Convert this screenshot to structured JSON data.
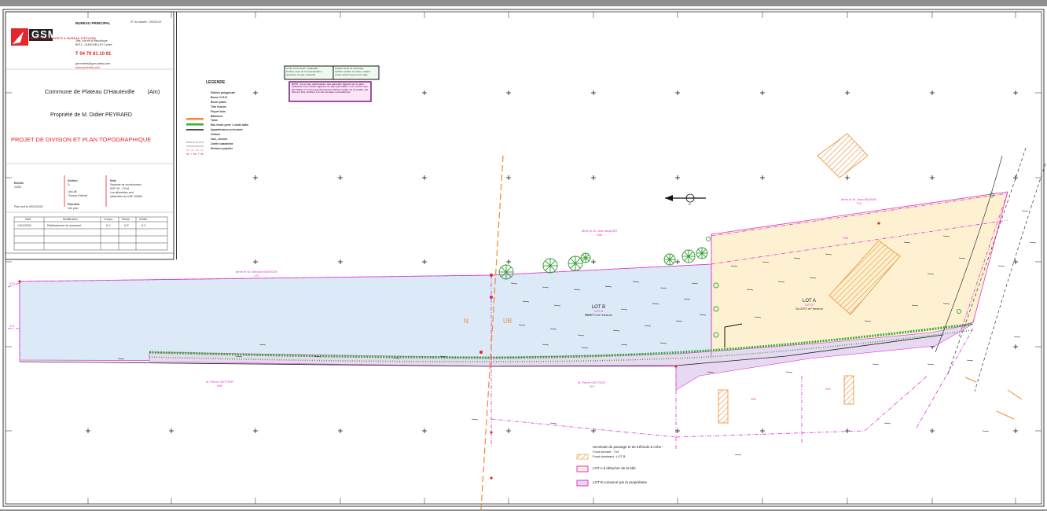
{
  "title_block": {
    "logo": "GSM",
    "logo_sub": "GÉOMÈTRES-EXPERTS & BUREAU D'ÉTUDES",
    "office": "BUREAU PRINCIPAL",
    "address": [
      "1bis, rue de la République",
      "BP12 - 01500 BELLEY Cedex"
    ],
    "phone": "T 04 79 81 10 91",
    "email": "geometres@gsm-belley.com",
    "web": "www.gsmbelley.com",
    "file_number": "N° du dossier : 2020/3 AT",
    "commune": "Commune de Plateau D'Hauteville",
    "department": "(Ain)",
    "owner": "Propriété de M. Didier PEYRARD",
    "project": "PROJET DE DIVISION ET PLAN TOPOGRAPHIQUE",
    "scale_label": "Echelle",
    "scale": "1/200",
    "section_label": "Section",
    "section": "D",
    "place_label": "Lieu-dit",
    "place": "\"Source d'Arbey\"",
    "parcels_label": "Parcelles",
    "parcels": "Voir plan",
    "plan_date": "Plan levé le 09/10/2020",
    "notes_label": "Note",
    "notes": [
      "Système de coordonnées",
      "RGF 93 - CC46",
      "Les altimétries sont",
      "rattachées au NGF-IGN69"
    ],
    "history_headers": [
      "Date",
      "Modification",
      "Compo",
      "Étudié",
      "Vérifié"
    ],
    "history_rows": [
      [
        "14/10/2020",
        "Etablissement du document",
        "K.C",
        "N.P",
        "K.C"
      ]
    ]
  },
  "legend": {
    "title": "LEGENDE",
    "items": [
      "Station polygonale",
      "Borne O.G.E.",
      "Borne plane",
      "Tête d'arbre",
      "Piquet bois",
      "Bâtiment",
      "Talus",
      "Mur limite privé / Limite bâtie",
      "Appartenance présumée",
      "Clôture",
      "Voie, chemin",
      "Limite cadastrale",
      "Division projetée"
    ]
  },
  "notes_boxes": {
    "green": [
      "Limite communale / cadastrale",
      "Surface issue de la représentation graphique du plan cadastral"
    ],
    "green_right": [
      "Surface issue du mesurage",
      "Surface vérifiée sur place, surface exacte déterminée par bornage"
    ],
    "purple": "NOTA : Au vu des informations des parcelles figurant sur le plan cadastral et les limites figurées au plan parcellaire, il en ressort que, des limites ne correspondent qu'aux limites réelles de propriété, qui devront être vérifiées lors du bornage contradictoire."
  },
  "plan": {
    "lot_a": "LOT A",
    "lot_a_ref": "1470.D",
    "lot_a_area": "Sa 2972 m² environ",
    "lot_b": "LOT B",
    "lot_b_ref": "1471.D",
    "lot_b_area": "Sa 4774 m² environ",
    "owner_bl": "Mme et M. Bernard MASSON",
    "owner_bl_ref": "470",
    "owner_top": "Mme et M. Jean MAZUIR",
    "owner_top_ref": "459",
    "owner_tr": "Mme et M. Jean MAZUIR",
    "owner_tr_ref": "710",
    "owner_bottom_left": "M. Pierre GEYTIER",
    "owner_bottom_left_ref": "885",
    "owner_bottom_mid": "M. Pierre GEYTIER",
    "owner_bottom_mid_ref": "719",
    "parcel_708": "708",
    "parcel_153": "153",
    "parcel_152": "152",
    "parcel_471": "471",
    "parcel_470": "470",
    "zone_n": "N",
    "zone_ub": "UB",
    "north": "N",
    "servitude_title": "Servitude de passage et de tréfonds à créer :",
    "servitude_items": [
      "Fond servant : 719",
      "Fond dominant : LOT B"
    ],
    "legend_lot_a": "LOT A à détacher de la bâti",
    "legend_lot_b": "LOT B conservé par la propriétaire"
  },
  "colors": {
    "lot_a_fill": "#fdf1d2",
    "lot_b_fill": "#dce9f7",
    "servitude_fill": "#e8d9f2",
    "magenta": "#e033d0",
    "red": "#e4262d",
    "orange": "#f08a2c",
    "green": "#3aa83a"
  }
}
